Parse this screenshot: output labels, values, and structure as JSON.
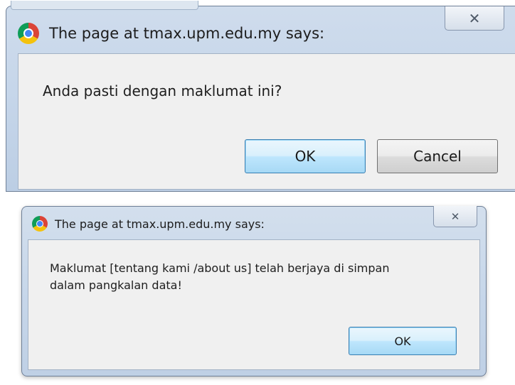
{
  "dialogs": [
    {
      "title": "The page at tmax.upm.edu.my says:",
      "message": "Anda pasti dengan maklumat ini?",
      "close_glyph": "✕",
      "buttons": {
        "ok": "OK",
        "cancel": "Cancel"
      }
    },
    {
      "title": "The page at tmax.upm.edu.my says:",
      "message_lines": [
        "Maklumat [tentang kami /about us] telah berjaya di simpan",
        "dalam pangkalan data!"
      ],
      "close_glyph": "✕",
      "buttons": {
        "ok": "OK"
      }
    }
  ],
  "icons": {
    "browser": "chrome-icon",
    "close": "close-icon"
  },
  "colors": {
    "frame": "#c6d6ea",
    "client": "#f0f0f0",
    "default_button": "#bee6fd",
    "button_border": "#707070"
  }
}
